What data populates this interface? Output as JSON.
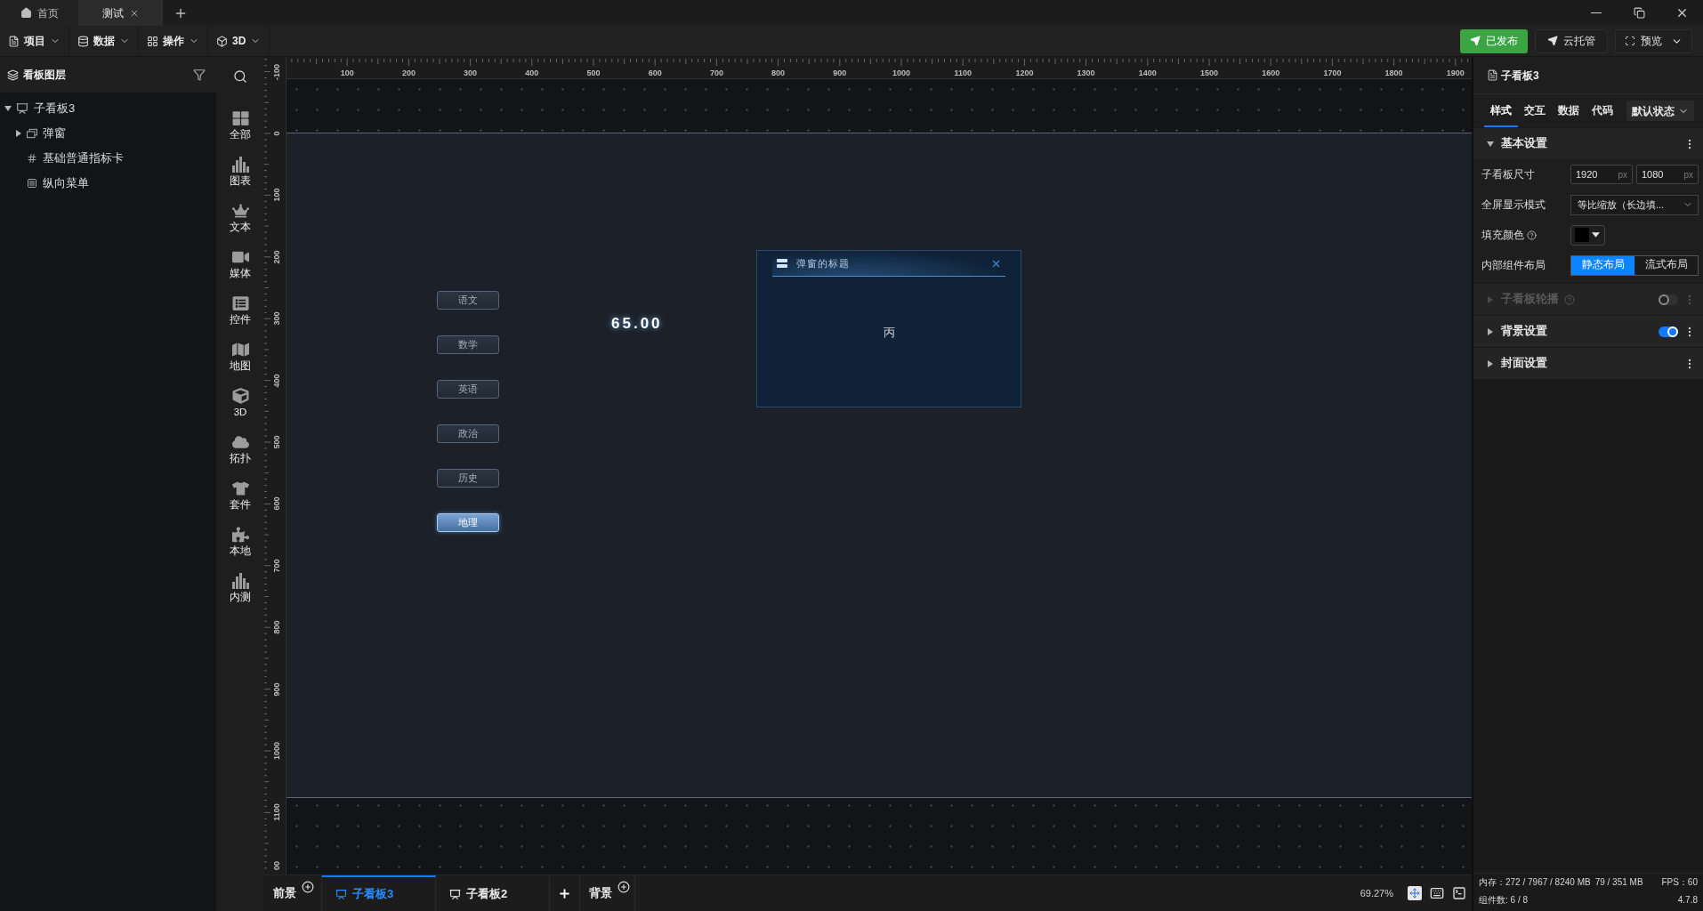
{
  "window_tabs": [
    {
      "label": "首页",
      "closable": false,
      "selected": false
    },
    {
      "label": "测试",
      "closable": true,
      "selected": true
    }
  ],
  "toolbar": {
    "menus": [
      {
        "label": "项目"
      },
      {
        "label": "数据"
      },
      {
        "label": "操作"
      },
      {
        "label": "3D"
      }
    ],
    "actions": [
      {
        "label": "已发布",
        "kind": "primary"
      },
      {
        "label": "云托管",
        "kind": "default"
      },
      {
        "label": "预览",
        "kind": "dropdown"
      }
    ]
  },
  "layers_panel": {
    "title": "看板图层",
    "tree": [
      {
        "label": "子看板3",
        "kind": "board",
        "expanded": true,
        "children": [
          {
            "label": "弹窗",
            "kind": "popup",
            "expanded": false
          },
          {
            "label": "基础普通指标卡",
            "kind": "metric"
          },
          {
            "label": "纵向菜单",
            "kind": "menu"
          }
        ]
      }
    ]
  },
  "categories": [
    {
      "label": "全部"
    },
    {
      "label": "图表"
    },
    {
      "label": "文本"
    },
    {
      "label": "媒体"
    },
    {
      "label": "控件"
    },
    {
      "label": "地图"
    },
    {
      "label": "3D"
    },
    {
      "label": "拓扑"
    },
    {
      "label": "套件"
    },
    {
      "label": "本地"
    },
    {
      "label": "内测"
    }
  ],
  "rulers": {
    "horizontal": [
      "100",
      "200",
      "300",
      "400",
      "500",
      "600",
      "700",
      "800",
      "900",
      "1000",
      "1100",
      "1200",
      "1300",
      "1400",
      "1500",
      "1600",
      "1700",
      "1800",
      "1900"
    ],
    "vertical": [
      "-100",
      "0",
      "100",
      "200",
      "300",
      "400",
      "500",
      "600",
      "700",
      "800",
      "900",
      "1000",
      "1100",
      "00"
    ]
  },
  "board": {
    "menu": [
      {
        "label": "语文",
        "selected": false
      },
      {
        "label": "数学",
        "selected": false
      },
      {
        "label": "英语",
        "selected": false
      },
      {
        "label": "政治",
        "selected": false
      },
      {
        "label": "历史",
        "selected": false
      },
      {
        "label": "地理",
        "selected": true
      }
    ],
    "metric_value": "65.00",
    "popup": {
      "title": "弹窗的标题",
      "content": "丙"
    }
  },
  "board_tabs": {
    "foreground": "前景",
    "boards": [
      {
        "label": "子看板3",
        "selected": true
      },
      {
        "label": "子看板2",
        "selected": false
      }
    ],
    "background": "背景"
  },
  "zoom_level": "69.27%",
  "properties": {
    "title": "子看板3",
    "tabs": [
      {
        "label": "样式",
        "selected": true
      },
      {
        "label": "交互",
        "selected": false
      },
      {
        "label": "数据",
        "selected": false
      },
      {
        "label": "代码",
        "selected": false
      }
    ],
    "state": "默认状态",
    "sections": [
      {
        "title": "基本设置",
        "kind": "plain",
        "expanded": true,
        "disabled": false,
        "help": false,
        "fields": [
          {
            "label": "子看板尺寸",
            "kind": "size",
            "help": false,
            "inputs": [
              {
                "value": "1920",
                "unit": "px"
              },
              {
                "value": "1080",
                "unit": "px"
              }
            ]
          },
          {
            "label": "全屏显示模式",
            "kind": "select",
            "help": false,
            "value": "等比缩放（长边填..."
          },
          {
            "label": "填充颜色",
            "kind": "color",
            "help": true,
            "color": "#000000"
          },
          {
            "label": "内部组件布局",
            "kind": "segmented",
            "help": false,
            "options": [
              {
                "label": "静态布局",
                "selected": true
              },
              {
                "label": "流式布局",
                "selected": false
              }
            ]
          }
        ]
      },
      {
        "title": "子看板轮播",
        "kind": "switch",
        "expanded": false,
        "disabled": true,
        "help": true,
        "on": false
      },
      {
        "title": "背景设置",
        "kind": "switch",
        "expanded": false,
        "disabled": false,
        "help": false,
        "on": true
      },
      {
        "title": "封面设置",
        "kind": "plain",
        "expanded": false,
        "disabled": false,
        "help": false
      }
    ]
  },
  "status": {
    "memory": "内存：272 / 7967 / 8240 MB",
    "gpu_memory": "79 / 351 MB",
    "fps": "FPS：60",
    "components": "组件数: 6 / 8",
    "version": "4.7.8"
  }
}
